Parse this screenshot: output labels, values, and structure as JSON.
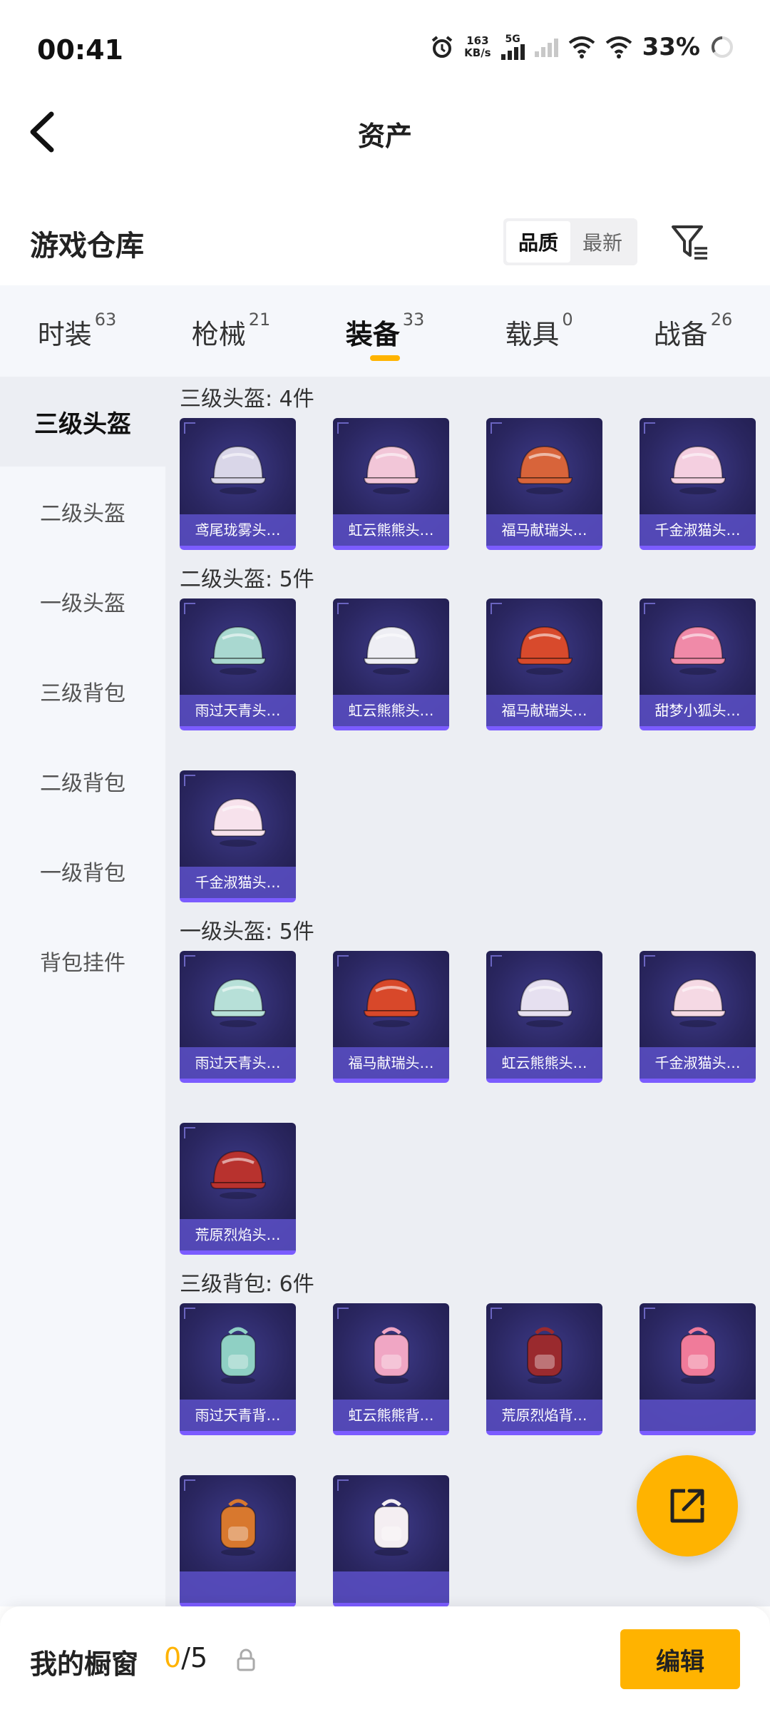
{
  "status": {
    "time": "00:41",
    "net_speed_value": "163",
    "net_speed_unit": "KB/s",
    "network_type": "5G",
    "battery": "33%"
  },
  "header": {
    "title": "资产"
  },
  "warehouse": {
    "title": "游戏仓库",
    "sort_options": [
      "品质",
      "最新"
    ],
    "active_sort": "品质"
  },
  "tabs": [
    {
      "label": "时装",
      "count": "63"
    },
    {
      "label": "枪械",
      "count": "21"
    },
    {
      "label": "装备",
      "count": "33",
      "active": true
    },
    {
      "label": "载具",
      "count": "0"
    },
    {
      "label": "战备",
      "count": "26"
    }
  ],
  "sidebar": {
    "items": [
      "三级头盔",
      "二级头盔",
      "一级头盔",
      "三级背包",
      "二级背包",
      "一级背包",
      "背包挂件"
    ],
    "active": "三级头盔"
  },
  "sections": [
    {
      "title": "三级头盔: 4件",
      "items": [
        {
          "name": "鸢尾珑雾头…",
          "icon": "helmet-icon",
          "color": "#d9d6e8"
        },
        {
          "name": "虹云熊熊头…",
          "icon": "helmet-icon",
          "color": "#f2c6d8"
        },
        {
          "name": "福马献瑞头…",
          "icon": "helmet-icon",
          "color": "#d8643a"
        },
        {
          "name": "千金淑猫头…",
          "icon": "helmet-icon",
          "color": "#f4cfe0"
        }
      ]
    },
    {
      "title": "二级头盔: 5件",
      "items": [
        {
          "name": "雨过天青头…",
          "icon": "helmet-icon",
          "color": "#a9d8d0"
        },
        {
          "name": "虹云熊熊头…",
          "icon": "helmet-icon",
          "color": "#eeeef4"
        },
        {
          "name": "福马献瑞头…",
          "icon": "helmet-icon",
          "color": "#d84a2c"
        },
        {
          "name": "甜梦小狐头…",
          "icon": "helmet-icon",
          "color": "#f08aa8"
        },
        {
          "name": "千金淑猫头…",
          "icon": "helmet-icon",
          "color": "#f7e2ec"
        }
      ]
    },
    {
      "title": "一级头盔: 5件",
      "items": [
        {
          "name": "雨过天青头…",
          "icon": "helmet-icon",
          "color": "#b7e0d8"
        },
        {
          "name": "福马献瑞头…",
          "icon": "helmet-icon",
          "color": "#d8482a"
        },
        {
          "name": "虹云熊熊头…",
          "icon": "helmet-icon",
          "color": "#e6e0f0"
        },
        {
          "name": "千金淑猫头…",
          "icon": "helmet-icon",
          "color": "#f5d9e4"
        },
        {
          "name": "荒原烈焰头…",
          "icon": "helmet-icon",
          "color": "#b8322e"
        }
      ]
    },
    {
      "title": "三级背包: 6件",
      "items": [
        {
          "name": "雨过天青背…",
          "icon": "backpack-icon",
          "color": "#8fd0c4"
        },
        {
          "name": "虹云熊熊背…",
          "icon": "backpack-icon",
          "color": "#f0a6c4"
        },
        {
          "name": "荒原烈焰背…",
          "icon": "backpack-icon",
          "color": "#9a2a2e"
        },
        {
          "name": "",
          "icon": "backpack-icon",
          "color": "#f07b9a"
        },
        {
          "name": "",
          "icon": "backpack-icon",
          "color": "#d8782e"
        },
        {
          "name": "",
          "icon": "backpack-icon",
          "color": "#f4eef2"
        }
      ]
    }
  ],
  "showcase": {
    "label": "我的橱窗",
    "current": "0",
    "separator": "/",
    "max": "5",
    "edit_label": "编辑"
  },
  "colors": {
    "accent": "#ffb300",
    "card_strip": "#5c50c8"
  }
}
